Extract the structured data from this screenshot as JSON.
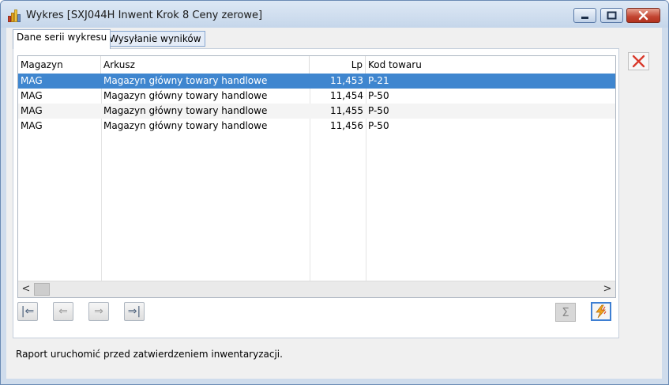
{
  "window": {
    "title": "Wykres [SXJ044H Inwent Krok 8 Ceny zerowe]",
    "controls": [
      "minimize-icon",
      "maximize-icon",
      "close-icon"
    ]
  },
  "tabs": [
    {
      "label": "Dane serii wykresu",
      "active": true
    },
    {
      "label": "Wysyłanie wyników",
      "active": false
    }
  ],
  "grid": {
    "columns": [
      "Magazyn",
      "Arkusz",
      "Lp",
      "Kod towaru"
    ],
    "rows": [
      {
        "magazyn": "MAG",
        "arkusz": "Magazyn główny towary handlowe",
        "lp": "11,453",
        "kod": "P-21",
        "selected": true
      },
      {
        "magazyn": "MAG",
        "arkusz": "Magazyn główny towary handlowe",
        "lp": "11,454",
        "kod": "P-50",
        "selected": false
      },
      {
        "magazyn": "MAG",
        "arkusz": "Magazyn główny towary handlowe",
        "lp": "11,455",
        "kod": "P-50",
        "selected": false
      },
      {
        "magazyn": "MAG",
        "arkusz": "Magazyn główny towary handlowe",
        "lp": "11,456",
        "kod": "P-50",
        "selected": false
      }
    ],
    "scroll_left_glyph": "<",
    "scroll_right_glyph": ">"
  },
  "nav": {
    "first_glyph": "|⇐",
    "prev_glyph": "⇐",
    "next_glyph": "⇒",
    "last_glyph": "⇒|"
  },
  "tools": {
    "sum_glyph": "Σ"
  },
  "status": "Raport uruchomić przed zatwierdzeniem inwentaryzacji.",
  "colors": {
    "selection": "#3f86cf",
    "delete_icon": "#d9382a",
    "flash_icon": "#f2a51c",
    "window_frame": "#cfdcec"
  }
}
